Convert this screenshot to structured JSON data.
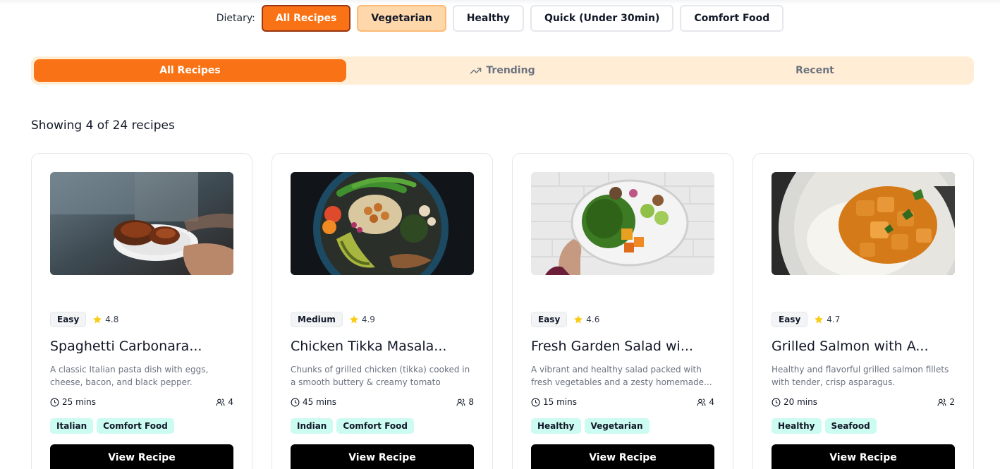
{
  "dietary": {
    "label": "Dietary:",
    "filters": [
      {
        "label": "All Recipes",
        "state": "active"
      },
      {
        "label": "Vegetarian",
        "state": "hover"
      },
      {
        "label": "Healthy",
        "state": "default"
      },
      {
        "label": "Quick (Under 30min)",
        "state": "default"
      },
      {
        "label": "Comfort Food",
        "state": "default"
      }
    ]
  },
  "tabs": [
    {
      "label": "All Recipes",
      "icon": "",
      "active": true
    },
    {
      "label": "Trending",
      "icon": "trending-up-icon",
      "active": false
    },
    {
      "label": "Recent",
      "icon": "",
      "active": false
    }
  ],
  "summary": "Showing 4 of 24 recipes",
  "colors": {
    "accent": "#f97316",
    "accent_soft": "#ffedd5",
    "tag_bg": "#ccfbf1",
    "star": "#facc15"
  },
  "recipes": [
    {
      "image": "grilled-chicken-photo",
      "difficulty": "Easy",
      "rating": "4.8",
      "title": "Spaghetti Carbonara...",
      "description": "A classic Italian pasta dish with eggs, cheese, bacon, and black pepper.",
      "time": "25 mins",
      "servings": "4",
      "tags": [
        "Italian",
        "Comfort Food"
      ],
      "button": "View Recipe"
    },
    {
      "image": "buddha-bowl-photo",
      "difficulty": "Medium",
      "rating": "4.9",
      "title": "Chicken Tikka Masala...",
      "description": "Chunks of grilled chicken (tikka) cooked in a smooth buttery & creamy tomato based...",
      "time": "45 mins",
      "servings": "8",
      "tags": [
        "Indian",
        "Comfort Food"
      ],
      "button": "View Recipe"
    },
    {
      "image": "salad-bowl-photo",
      "difficulty": "Easy",
      "rating": "4.6",
      "title": "Fresh Garden Salad wi...",
      "description": "A vibrant and healthy salad packed with fresh vegetables and a zesty homemade...",
      "time": "15 mins",
      "servings": "4",
      "tags": [
        "Healthy",
        "Vegetarian"
      ],
      "button": "View Recipe"
    },
    {
      "image": "curry-rice-photo",
      "difficulty": "Easy",
      "rating": "4.7",
      "title": "Grilled Salmon with A...",
      "description": "Healthy and flavorful grilled salmon fillets with tender, crisp asparagus.",
      "time": "20 mins",
      "servings": "2",
      "tags": [
        "Healthy",
        "Seafood"
      ],
      "button": "View Recipe"
    }
  ]
}
